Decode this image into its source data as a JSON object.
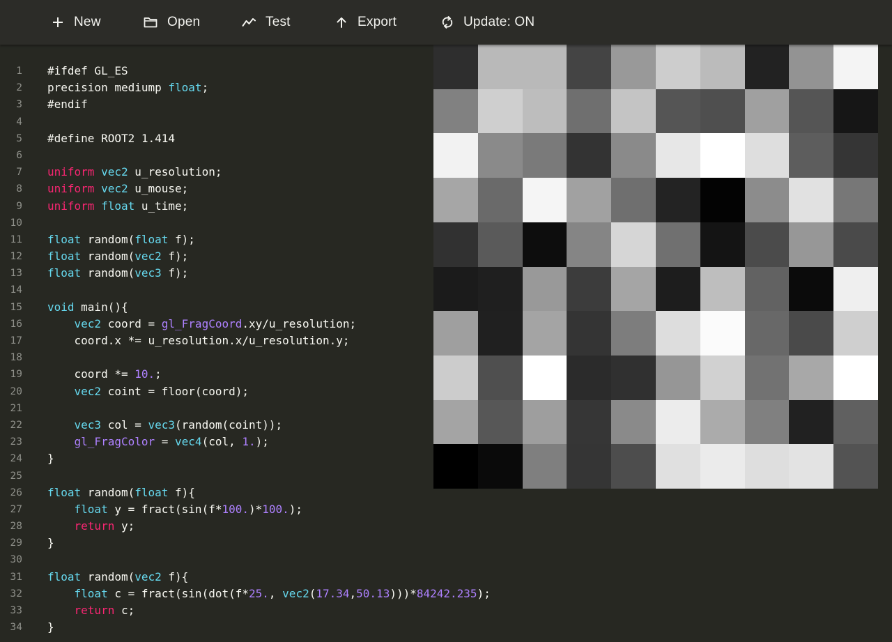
{
  "toolbar": {
    "new_label": "New",
    "open_label": "Open",
    "test_label": "Test",
    "export_label": "Export",
    "update_label": "Update: ON"
  },
  "editor": {
    "line_numbers": [
      "1",
      "2",
      "3",
      "4",
      "5",
      "6",
      "7",
      "8",
      "9",
      "10",
      "11",
      "12",
      "13",
      "14",
      "15",
      "16",
      "17",
      "18",
      "19",
      "20",
      "21",
      "22",
      "23",
      "24",
      "25",
      "26",
      "27",
      "28",
      "29",
      "30",
      "31",
      "32",
      "33",
      "34"
    ],
    "lines": [
      [
        [
          "#ifdef GL_ES",
          ""
        ]
      ],
      [
        [
          "precision mediump ",
          ""
        ],
        [
          "float",
          "ty"
        ],
        [
          ";",
          ""
        ]
      ],
      [
        [
          "#endif",
          ""
        ]
      ],
      [],
      [
        [
          "#define ROOT2 1.414",
          ""
        ]
      ],
      [],
      [
        [
          "uniform",
          "kw"
        ],
        [
          " ",
          ""
        ],
        [
          "vec2",
          "ty"
        ],
        [
          " u_resolution;",
          ""
        ]
      ],
      [
        [
          "uniform",
          "kw"
        ],
        [
          " ",
          ""
        ],
        [
          "vec2",
          "ty"
        ],
        [
          " u_mouse;",
          ""
        ]
      ],
      [
        [
          "uniform",
          "kw"
        ],
        [
          " ",
          ""
        ],
        [
          "float",
          "ty"
        ],
        [
          " u_time;",
          ""
        ]
      ],
      [],
      [
        [
          "float",
          "ty"
        ],
        [
          " random(",
          ""
        ],
        [
          "float",
          "ty"
        ],
        [
          " f);",
          ""
        ]
      ],
      [
        [
          "float",
          "ty"
        ],
        [
          " random(",
          ""
        ],
        [
          "vec2",
          "ty"
        ],
        [
          " f);",
          ""
        ]
      ],
      [
        [
          "float",
          "ty"
        ],
        [
          " random(",
          ""
        ],
        [
          "vec3",
          "ty"
        ],
        [
          " f);",
          ""
        ]
      ],
      [],
      [
        [
          "void",
          "ty"
        ],
        [
          " main(){",
          ""
        ]
      ],
      [
        [
          "    ",
          ""
        ],
        [
          "vec2",
          "ty"
        ],
        [
          " coord = ",
          ""
        ],
        [
          "gl_FragCoord",
          "bi"
        ],
        [
          ".xy/u_resolution;",
          ""
        ]
      ],
      [
        [
          "    coord.x *= u_resolution.x/u_resolution.y;",
          ""
        ]
      ],
      [],
      [
        [
          "    coord *= ",
          ""
        ],
        [
          "10.",
          "num"
        ],
        [
          ";",
          ""
        ]
      ],
      [
        [
          "    ",
          ""
        ],
        [
          "vec2",
          "ty"
        ],
        [
          " coint = floor(coord);",
          ""
        ]
      ],
      [],
      [
        [
          "    ",
          ""
        ],
        [
          "vec3",
          "ty"
        ],
        [
          " col = ",
          ""
        ],
        [
          "vec3",
          "ty"
        ],
        [
          "(random(coint));",
          ""
        ]
      ],
      [
        [
          "    ",
          ""
        ],
        [
          "gl_FragColor",
          "bi"
        ],
        [
          " = ",
          ""
        ],
        [
          "vec4",
          "ty"
        ],
        [
          "(col, ",
          ""
        ],
        [
          "1.",
          "num"
        ],
        [
          ");",
          ""
        ]
      ],
      [
        [
          "}",
          ""
        ]
      ],
      [],
      [
        [
          "float",
          "ty"
        ],
        [
          " random(",
          ""
        ],
        [
          "float",
          "ty"
        ],
        [
          " f){",
          ""
        ]
      ],
      [
        [
          "    ",
          ""
        ],
        [
          "float",
          "ty"
        ],
        [
          " y = fract(sin(f*",
          ""
        ],
        [
          "100.",
          "num"
        ],
        [
          ")*",
          ""
        ],
        [
          "100.",
          "num"
        ],
        [
          ");",
          ""
        ]
      ],
      [
        [
          "    ",
          ""
        ],
        [
          "return",
          "kw"
        ],
        [
          " y;",
          ""
        ]
      ],
      [
        [
          "}",
          ""
        ]
      ],
      [],
      [
        [
          "float",
          "ty"
        ],
        [
          " random(",
          ""
        ],
        [
          "vec2",
          "ty"
        ],
        [
          " f){",
          ""
        ]
      ],
      [
        [
          "    ",
          ""
        ],
        [
          "float",
          "ty"
        ],
        [
          " c = fract(sin(dot(f*",
          ""
        ],
        [
          "25.",
          "num"
        ],
        [
          ", ",
          ""
        ],
        [
          "vec2",
          "ty"
        ],
        [
          "(",
          ""
        ],
        [
          "17.34",
          "num"
        ],
        [
          ",",
          ""
        ],
        [
          "50.13",
          "num"
        ],
        [
          ")))*",
          ""
        ],
        [
          "84242.235",
          "num"
        ],
        [
          ");",
          ""
        ]
      ],
      [
        [
          "    ",
          ""
        ],
        [
          "return",
          "kw"
        ],
        [
          " c;",
          ""
        ]
      ],
      [
        [
          "}",
          ""
        ]
      ]
    ]
  },
  "canvas": {
    "grid": [
      [
        "#2e2e2e",
        "#b9b9b9",
        "#b9b9b9",
        "#444444",
        "#999999",
        "#cdcdcd",
        "#bbbbbb",
        "#222222",
        "#939393",
        "#f4f4f4"
      ],
      [
        "#818181",
        "#cfcfcf",
        "#bdbdbd",
        "#6f6f6f",
        "#c4c4c4",
        "#555555",
        "#4f4f4f",
        "#a0a0a0",
        "#555555",
        "#161616"
      ],
      [
        "#f2f2f2",
        "#8a8a8a",
        "#7a7a7a",
        "#333333",
        "#8a8a8a",
        "#e7e7e7",
        "#ffffff",
        "#dedede",
        "#5d5d5d",
        "#353535"
      ],
      [
        "#a6a6a6",
        "#6a6a6a",
        "#f5f5f5",
        "#a1a1a1",
        "#6f6f6f",
        "#232323",
        "#030303",
        "#8c8c8c",
        "#e1e1e1",
        "#777777"
      ],
      [
        "#313131",
        "#5a5a5a",
        "#0d0d0d",
        "#858585",
        "#d6d6d6",
        "#707070",
        "#141414",
        "#4b4b4b",
        "#979797",
        "#4a4a4a"
      ],
      [
        "#1b1b1b",
        "#1f1f1f",
        "#999999",
        "#3c3c3c",
        "#a5a5a5",
        "#1d1d1d",
        "#bebebe",
        "#626262",
        "#0b0b0b",
        "#efefef"
      ],
      [
        "#9f9f9f",
        "#202020",
        "#a4a4a4",
        "#343434",
        "#7d7d7d",
        "#dddddd",
        "#fbfbfb",
        "#686868",
        "#4a4a4a",
        "#cfcfcf"
      ],
      [
        "#cccccc",
        "#4f4f4f",
        "#ffffff",
        "#2b2b2b",
        "#303030",
        "#969696",
        "#d1d1d1",
        "#727272",
        "#a8a8a8",
        "#ffffff"
      ],
      [
        "#a4a4a4",
        "#575757",
        "#9e9e9e",
        "#363636",
        "#8a8a8a",
        "#ececec",
        "#ababab",
        "#808080",
        "#212121",
        "#606060"
      ],
      [
        "#000000",
        "#0a0a0a",
        "#7f7f7f",
        "#353535",
        "#4d4d4d",
        "#e0e0e0",
        "#ebebeb",
        "#dedede",
        "#e3e3e3",
        "#535353"
      ]
    ]
  },
  "colors": {
    "background": "#272822",
    "toolbar": "#2c2c28",
    "keyword": "#f92672",
    "type": "#66d9ef",
    "number": "#ae81ff",
    "text": "#f8f8f2"
  }
}
